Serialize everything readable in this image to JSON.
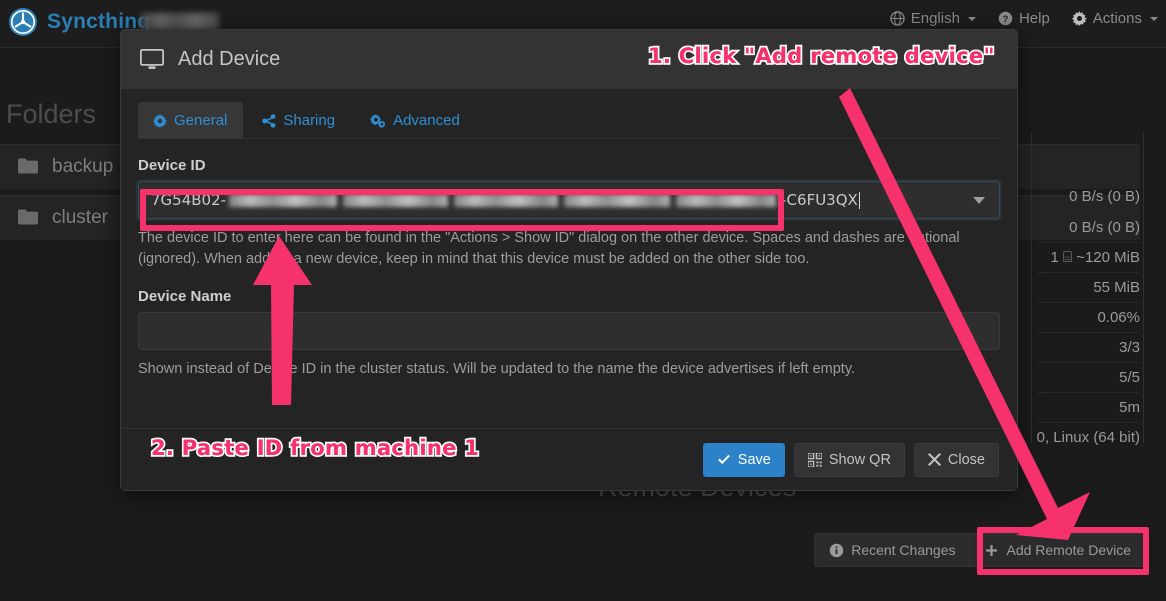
{
  "navbar": {
    "brand": "Syncthing",
    "items": [
      {
        "label": "English",
        "icon": "globe-icon",
        "caret": true
      },
      {
        "label": "Help",
        "icon": "question-circle-icon",
        "caret": false
      },
      {
        "label": "Actions",
        "icon": "gear-icon",
        "caret": true
      }
    ]
  },
  "page": {
    "folders_heading": "Folders",
    "remote_devices_heading": "Remote Devices",
    "folders": [
      {
        "name": "backup",
        "icon": "folder-icon"
      },
      {
        "name": "cluster",
        "icon": "folder-icon"
      }
    ],
    "stats": [
      {
        "value": "0 B/s (0 B)",
        "green": false
      },
      {
        "value": "0 B/s (0 B)",
        "green": false
      },
      {
        "value": "1 ⌸ ~120 MiB",
        "green": false
      },
      {
        "value": "55 MiB",
        "green": false
      },
      {
        "value": "0.06%",
        "green": false
      },
      {
        "value": "3/3",
        "green": true
      },
      {
        "value": "5/5",
        "green": true
      },
      {
        "value": "5m",
        "green": false
      },
      {
        "value": "0, Linux (64 bit)",
        "green": false
      }
    ],
    "buttons": [
      {
        "label": "Recent Changes",
        "icon": "info-circle-icon"
      },
      {
        "label": "Add Remote Device",
        "icon": "plus-icon"
      }
    ]
  },
  "modal": {
    "title": "Add Device",
    "title_icon": "desktop-icon",
    "tabs": [
      {
        "label": "General",
        "icon": "gear-icon",
        "active": true
      },
      {
        "label": "Sharing",
        "icon": "share-icon",
        "active": false
      },
      {
        "label": "Advanced",
        "icon": "sliders-icon",
        "active": false
      }
    ],
    "device_id": {
      "label": "Device ID",
      "value_prefix": "7G54B02-",
      "value_suffix": "–C6FU3QX",
      "help": "The device ID to enter here can be found in the \"Actions > Show ID\" dialog on the other device. Spaces and dashes are optional (ignored). When adding a new device, keep in mind that this device must be added on the other side too."
    },
    "device_name": {
      "label": "Device Name",
      "value": "",
      "help": "Shown instead of Device ID in the cluster status. Will be updated to the name the device advertises if left empty."
    },
    "footer": [
      {
        "label": "Save",
        "icon": "check-icon",
        "primary": true
      },
      {
        "label": "Show QR",
        "icon": "qrcode-icon",
        "primary": false
      },
      {
        "label": "Close",
        "icon": "close-icon",
        "primary": false
      }
    ]
  },
  "annotations": {
    "step1": "1. Click \"Add remote device\"",
    "step2": "2. Paste ID from machine 1",
    "accent_color": "#f5326b"
  }
}
